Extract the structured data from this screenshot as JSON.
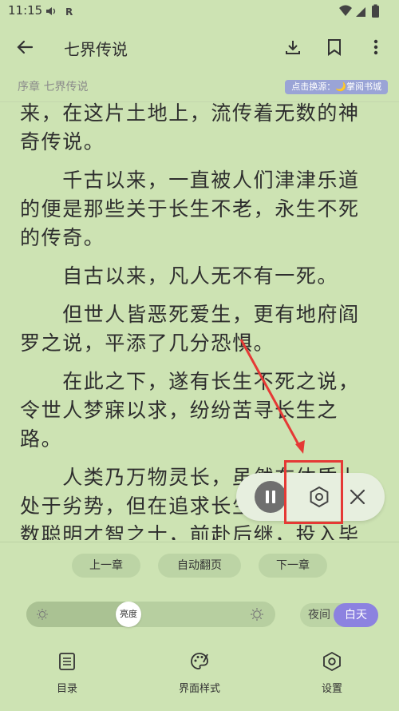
{
  "status_bar": {
    "time": "11:15",
    "left_icons": [
      "volume-icon",
      "r-icon"
    ],
    "right_icons": [
      "wifi-icon",
      "signal-icon",
      "battery-icon"
    ]
  },
  "app_bar": {
    "title": "七界传说"
  },
  "reader": {
    "chapter": "序章 七界传说",
    "source_badge": "点击换源：🌙掌阅书城",
    "paragraphs": [
      "来，在这片土地上，流传着无数的神奇传说。",
      "　　千古以来，一直被人们津津乐道的便是那些关于长生不老，永生不死的传奇。",
      "　　自古以来，凡人无不有一死。",
      "　　但世人皆恶死爱生，更有地府阎罗之说，平添了几分恐惧。",
      "　　在此之下，遂有长生不死之说，令世人梦寐以求，纷纷苦寻长生之路。",
      "　　人类乃万物灵长，虽然在体质上处于劣势，但在追求长生之路上，无数聪明才智之士，前赴后继，投入毕生精力，苦苦钻研。"
    ]
  },
  "panel": {
    "prev_chapter": "上一章",
    "auto_page": "自动翻页",
    "next_chapter": "下一章",
    "brightness_label": "亮度",
    "brightness_level": 0.4,
    "night": "夜间",
    "day": "白天",
    "nav": {
      "catalog": "目录",
      "style": "界面样式",
      "settings": "设置"
    }
  },
  "colors": {
    "background": "#cde3b3",
    "accent": "#8c82e0",
    "highlight": "#e53935"
  }
}
